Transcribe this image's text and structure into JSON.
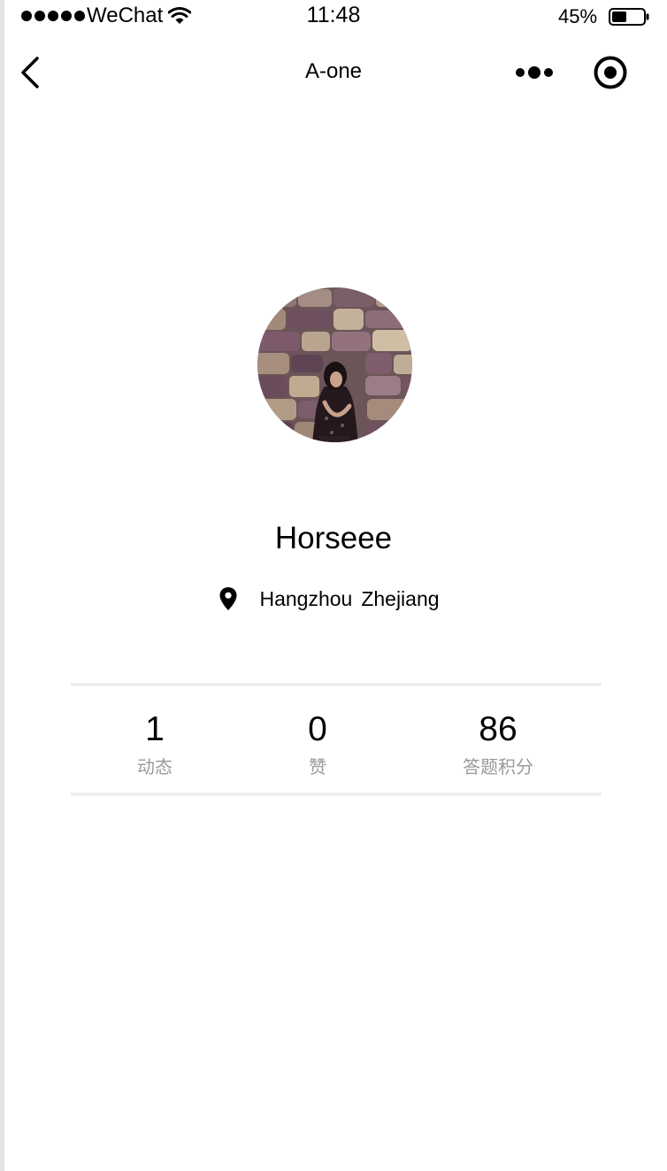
{
  "status_bar": {
    "carrier": "WeChat",
    "time": "11:48",
    "battery_percent": "45%"
  },
  "nav": {
    "title": "A-one",
    "back_icon": "chevron-left-icon",
    "more_icon": "more-dots-icon",
    "capsule_icon": "target-circle-icon"
  },
  "profile": {
    "avatar_icon": "avatar-photo",
    "name": "Horseee",
    "location_icon": "map-pin-icon",
    "city": "Hangzhou",
    "province": "Zhejiang"
  },
  "stats": [
    {
      "value": "1",
      "label": "动态"
    },
    {
      "value": "0",
      "label": "赞"
    },
    {
      "value": "86",
      "label": "答题积分"
    }
  ],
  "colors": {
    "divider": "#eeeeee",
    "label_gray": "#999999",
    "text": "#000000"
  }
}
